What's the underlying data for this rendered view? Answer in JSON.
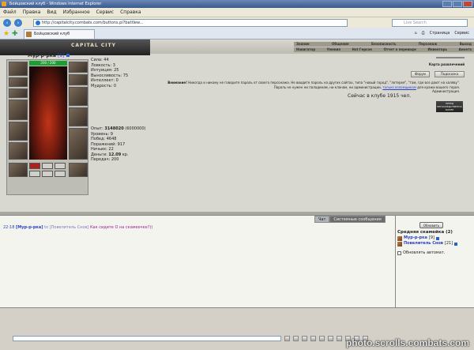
{
  "window": {
    "title": "Бойцовский клуб - Windows Internet Explorer"
  },
  "menu": [
    "Файл",
    "Правка",
    "Вид",
    "Избранное",
    "Сервис",
    "Справка"
  ],
  "address": {
    "url": "http://capitalcity.combats.com/buttons.pl?battlew..."
  },
  "search": {
    "placeholder": "Live Search"
  },
  "tab": {
    "label": "Бойцовский клуб"
  },
  "commands": [
    "Страница",
    "Сервис"
  ],
  "game": {
    "logo": "CAPITAL CITY",
    "nav_top": [
      "Знание",
      "Общение",
      "Безопасность",
      "Персонаж",
      "Выход"
    ],
    "nav_bottom": [
      "Навигатор",
      "Умения",
      "Hot Герсон",
      "Отчет о переводе",
      "Инвентарь",
      "Анкета"
    ],
    "character": {
      "name": "Мур-р-рка",
      "level": "[9]",
      "hp": "200 / 200"
    },
    "stats": [
      "Сила: 44",
      "Ловкость: 3",
      "Интуиция: 25",
      "Выносливость: 75",
      "Интеллект: 0",
      "Мудрость: 0"
    ],
    "experience": {
      "label": "Опыт:",
      "value": "3148020",
      "next": "(6000000)"
    },
    "stats2": [
      "Уровень: 9",
      "Побед: 4648",
      "Поражений: 917",
      "Ничьих: 22"
    ],
    "money": {
      "label": "Деньги:",
      "value": "12.09",
      "unit": "кр."
    },
    "transfers": "Передач: 200",
    "buttons": {
      "forum": "Форум",
      "tip": "Подсказка",
      "green": "Карта развлечений"
    },
    "warning": {
      "label": "Внимание!",
      "text": "Никогда и никому не говорите пароль от своего персонажа. Не вводите пароль на других сайтах, типа \"новый город\", \"лотерея\", \"там, где все дают на халяву\". Пароль не нужен ни паладинам, ни кланам, ни администрации,",
      "link": "только взломщикам",
      "tail": "для кражи вашего героя.",
      "signature": "Администрация."
    },
    "online": "Сейчас в клубе 1915 чел.",
    "plate": "ПЕРЕД НЕПОСРЕДСТВЕННО БОЛЕЕ"
  },
  "chat": {
    "tabs": {
      "active": "Чат",
      "inactive": "Системные сообщения"
    },
    "line": {
      "time": "22:18",
      "from": "[Мур-р-рка]",
      "to": "to [Повелитель Снов]",
      "message": "Как сидите О на скамеечке?))"
    }
  },
  "side": {
    "refresh": "Обновить",
    "room": "Средняя скамейка (2)",
    "users": [
      {
        "name": "Мур-р-рка",
        "level": "[9]"
      },
      {
        "name": "Повелитель Снов",
        "level": "[21]"
      }
    ],
    "auto_refresh": "Обновлять автомат."
  },
  "watermark": "photo.scrolls.combats.com"
}
